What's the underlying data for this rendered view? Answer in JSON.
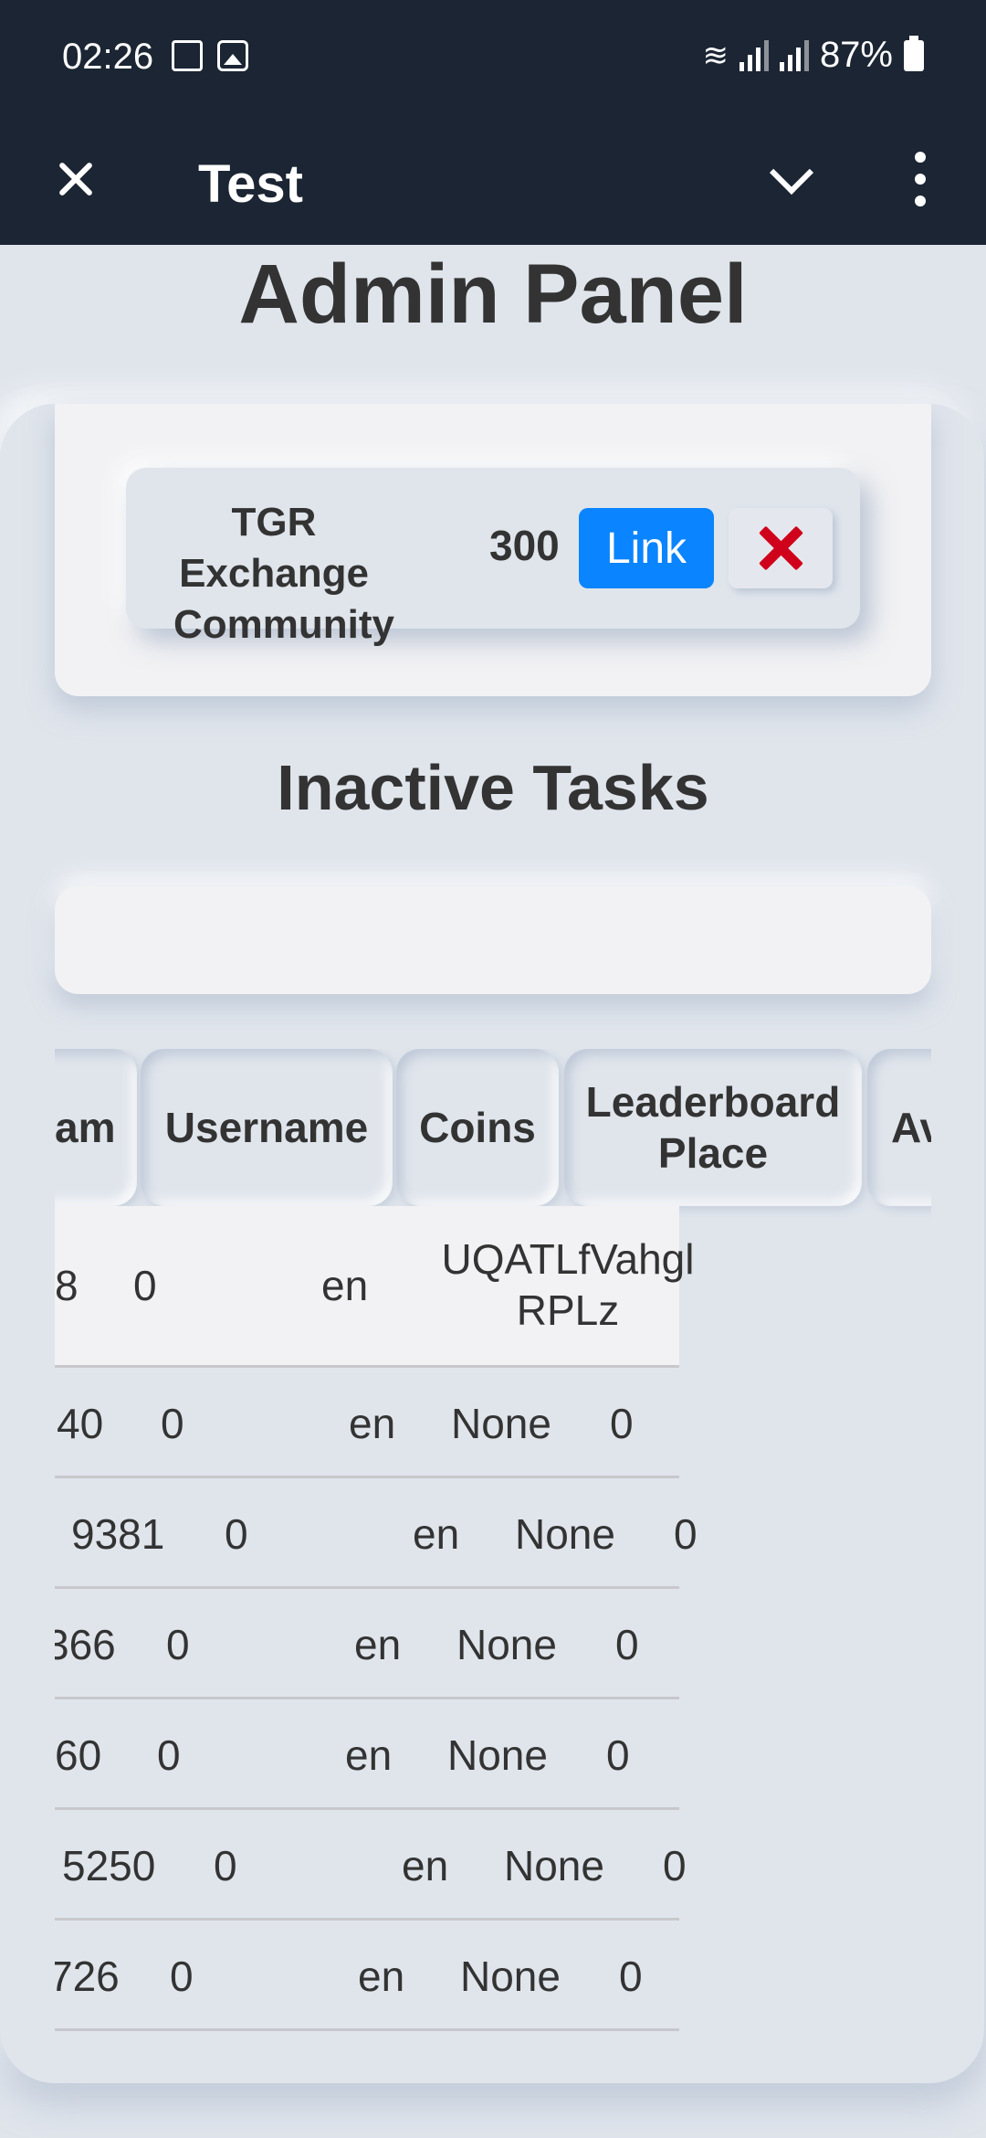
{
  "status_bar": {
    "time": "02:26",
    "battery": "87%"
  },
  "app_bar": {
    "title": "Test"
  },
  "page": {
    "title": "Admin Panel",
    "inactive_title": "Inactive Tasks"
  },
  "active_task": {
    "name": "TGR Exchange Community",
    "coins": "300",
    "link_label": "Link"
  },
  "table": {
    "headers": [
      "am",
      "Username",
      "Coins",
      "Leaderboard Place",
      "Av"
    ],
    "rows": [
      [
        "8",
        "0",
        "en",
        "UQATLfVahgl RPLz",
        ""
      ],
      [
        "40",
        "0",
        "en",
        "None",
        "0"
      ],
      [
        "9381",
        "0",
        "en",
        "None",
        "0"
      ],
      [
        "366",
        "0",
        "en",
        "None",
        "0"
      ],
      [
        "60",
        "0",
        "en",
        "None",
        "0"
      ],
      [
        "5250",
        "0",
        "en",
        "None",
        "0"
      ],
      [
        "726",
        "0",
        "en",
        "None",
        "0"
      ]
    ]
  }
}
